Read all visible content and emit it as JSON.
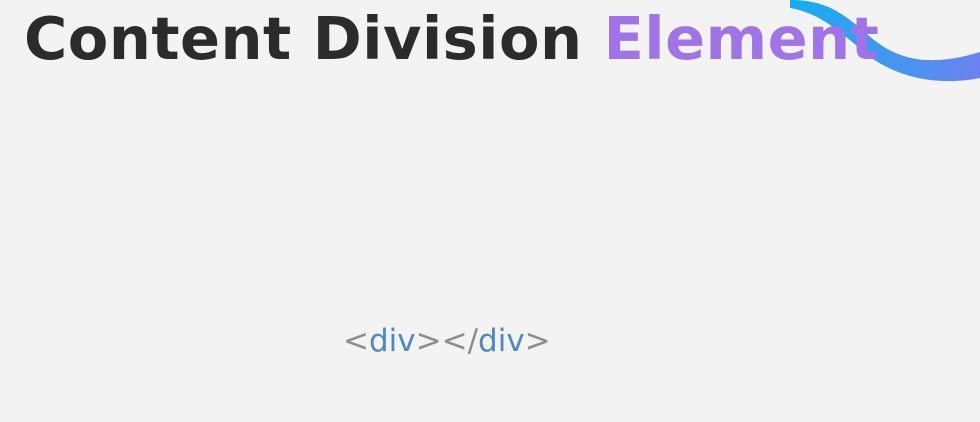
{
  "slide": {
    "title": {
      "main": "Content Division ",
      "accent": "Element"
    },
    "code": {
      "open_bracket": "<",
      "open_tag": "div",
      "open_close_bracket": ">",
      "close_bracket": "</",
      "close_tag": "div",
      "close_end_bracket": ">"
    }
  },
  "colors": {
    "background": "#f3f3f3",
    "title_text": "#2b2b2b",
    "title_accent": "#a173e8",
    "code_brackets": "#8d8d8d",
    "code_tagname": "#4d89c7",
    "wave_gradient_start": "#14aef0",
    "wave_gradient_end": "#6b82f0"
  },
  "icons": {
    "decorative_wave": "wave-decoration-icon"
  }
}
